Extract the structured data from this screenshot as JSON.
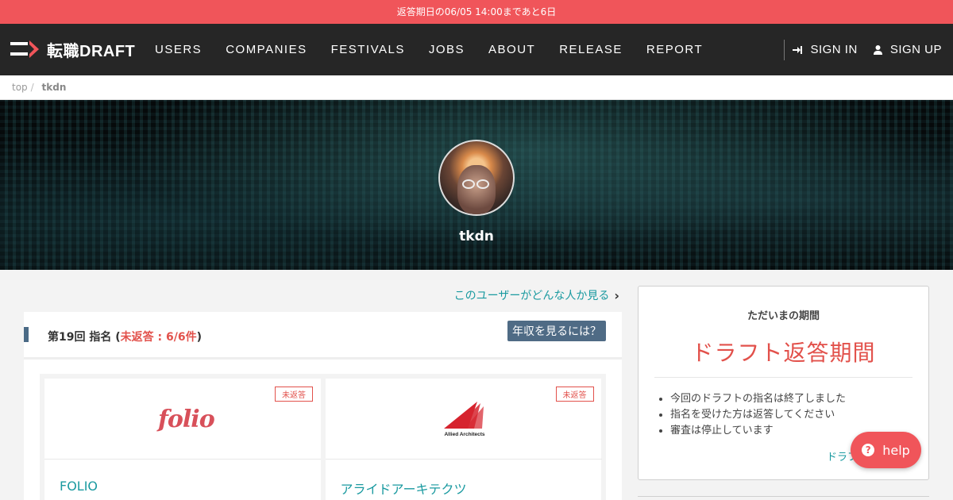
{
  "banner": {
    "text": "返答期日の06/05 14:00まであと6日"
  },
  "nav": {
    "logo_text": "転職DRAFT",
    "items": [
      {
        "label": "USERS"
      },
      {
        "label": "COMPANIES"
      },
      {
        "label": "FESTIVALS"
      },
      {
        "label": "JOBS"
      },
      {
        "label": "ABOUT"
      },
      {
        "label": "RELEASE"
      },
      {
        "label": "REPORT"
      }
    ],
    "sign_in": "SIGN IN",
    "sign_up": "SIGN UP"
  },
  "breadcrumb": {
    "home": "top",
    "separator": "/",
    "current": "tkdn"
  },
  "profile": {
    "name": "tkdn"
  },
  "main": {
    "user_link": "このユーザーがどんな人か見る",
    "panel_title_prefix": "第19回 指名 (",
    "panel_title_status": "未返答 : 6/6件",
    "panel_title_suffix": ")",
    "salary_button": "年収を見るには？",
    "cards": [
      {
        "logo_text": "folio",
        "badge": "未返答",
        "name": "FOLIO"
      },
      {
        "logo_text": "Allied Architects",
        "badge": "未返答",
        "name": "アライドアーキテクツ"
      }
    ]
  },
  "sidebar": {
    "label": "ただいまの期間",
    "title": "ドラフト返答期間",
    "items": [
      "今回のドラフトの指名は終了しました",
      "指名を受けた方は返答してください",
      "審査は停止しています"
    ],
    "link": "ドラフ"
  },
  "help": {
    "label": "help"
  },
  "colors": {
    "accent": "#f0555a",
    "nav_bg": "#262626",
    "link": "#1a9aa0",
    "button": "#4f6b85"
  }
}
